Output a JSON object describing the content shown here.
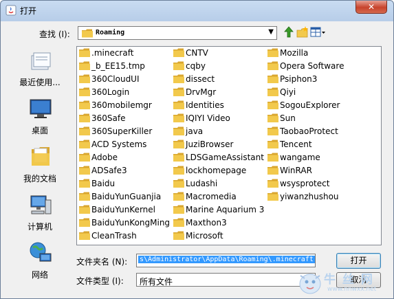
{
  "window": {
    "title": "打开",
    "close_glyph": "✕"
  },
  "toolbar": {
    "look_in_label": "查找 (I):",
    "look_in_value": "Roaming",
    "look_in_arrow": "▼",
    "icons": [
      "up-one-level-icon",
      "create-new-folder-icon",
      "view-menu-icon"
    ]
  },
  "places": [
    {
      "label": "最近使用...",
      "icon": "recent-items-icon"
    },
    {
      "label": "桌面",
      "icon": "desktop-icon"
    },
    {
      "label": "我的文档",
      "icon": "my-documents-icon"
    },
    {
      "label": "计算机",
      "icon": "computer-icon"
    },
    {
      "label": "网络",
      "icon": "network-icon"
    }
  ],
  "files": {
    "columns": [
      [
        ".minecraft",
        "_b_EE15.tmp",
        "360CloudUI",
        "360Login",
        "360mobilemgr",
        "360Safe",
        "360SuperKiller",
        "ACD Systems",
        "Adobe",
        "ADSafe3",
        "Baidu",
        "BaiduYunGuanjia",
        "BaiduYunKernel",
        "BaiduYunKongMing",
        "CleanTrash"
      ],
      [
        "CNTV",
        "cqby",
        "dissect",
        "DrvMgr",
        "Identities",
        "IQIYI Video",
        "java",
        "JuziBrowser",
        "LDSGameAssistant",
        "lockhomepage",
        "Ludashi",
        "Macromedia",
        "Marine Aquarium 3",
        "Maxthon3",
        "Microsoft"
      ],
      [
        "Mozilla",
        "Opera Software",
        "Psiphon3",
        "Qiyi",
        "SogouExplorer",
        "Sun",
        "TaobaoProtect",
        "Tencent",
        "wangame",
        "WinRAR",
        "wsysprotect",
        "yiwanzhushou"
      ]
    ]
  },
  "filename": {
    "label": "文件夹名 (N):",
    "value": "s\\Administrator\\AppData\\Roaming\\.minecraft"
  },
  "filetype": {
    "label": "文件类型 (I):",
    "value": "所有文件"
  },
  "buttons": {
    "open": "打开",
    "cancel": "取消"
  },
  "watermark": {
    "text": "牛 丝 网",
    "url": "www.nnwxx.net"
  },
  "colors": {
    "folder": "#f2c94c",
    "folder_dark": "#d9a62e",
    "selection": "#3399ff",
    "title_gradient": "#c9dcf2",
    "close": "#c7432c"
  }
}
